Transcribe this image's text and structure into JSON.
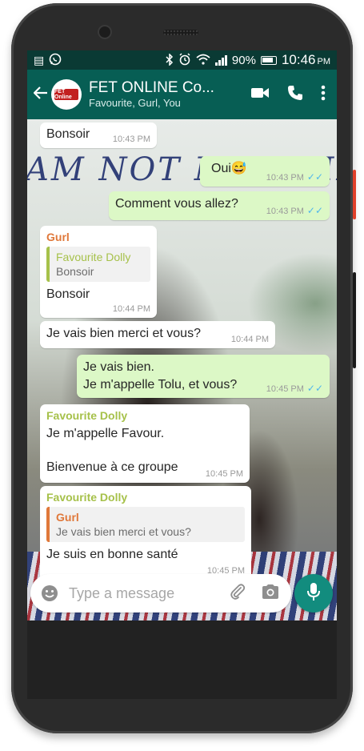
{
  "status_bar": {
    "battery": "90%",
    "time": "10:46",
    "period": "PM"
  },
  "header": {
    "title": "FET ONLINE Co...",
    "members": "Favourite, Gurl, You",
    "avatar_text": "FET Online"
  },
  "background": {
    "graffiti": "AM NOT MY HAIR"
  },
  "messages": [
    {
      "text": "Bonsoir",
      "time": "10:43 PM"
    },
    {
      "text": "Oui😅",
      "time": "10:43 PM"
    },
    {
      "text": "Comment vous allez?",
      "time": "10:43 PM"
    },
    {
      "sender": "Gurl",
      "quote_name": "Favourite Dolly",
      "quote_text": "Bonsoir",
      "text": "Bonsoir",
      "time": "10:44 PM"
    },
    {
      "text": "Je vais bien merci et vous?",
      "time": "10:44 PM"
    },
    {
      "line1": "Je vais bien.",
      "line2": "Je m'appelle Tolu, et vous?",
      "time": "10:45 PM"
    },
    {
      "sender": "Favourite Dolly",
      "line1": "Je m'appelle Favour.",
      "line2": "Bienvenue à ce groupe",
      "time": "10:45 PM"
    },
    {
      "sender": "Favourite Dolly",
      "quote_name": "Gurl",
      "quote_text": "Je vais bien merci et vous?",
      "text": "Je suis en bonne santé",
      "time": "10:45 PM"
    }
  ],
  "input": {
    "placeholder": "Type a message"
  },
  "icons": {
    "back": "arrow-left-icon",
    "video": "video-call-icon",
    "call": "phone-icon",
    "menu": "more-vert-icon",
    "emoji": "emoji-icon",
    "attach": "paperclip-icon",
    "camera": "camera-icon",
    "mic": "microphone-icon"
  },
  "colors": {
    "header": "#075e54",
    "outgoing_bubble": "#dcf8c6",
    "incoming_bubble": "#ffffff",
    "mic_button": "#128c7e",
    "read_ticks": "#4fb6ec"
  }
}
